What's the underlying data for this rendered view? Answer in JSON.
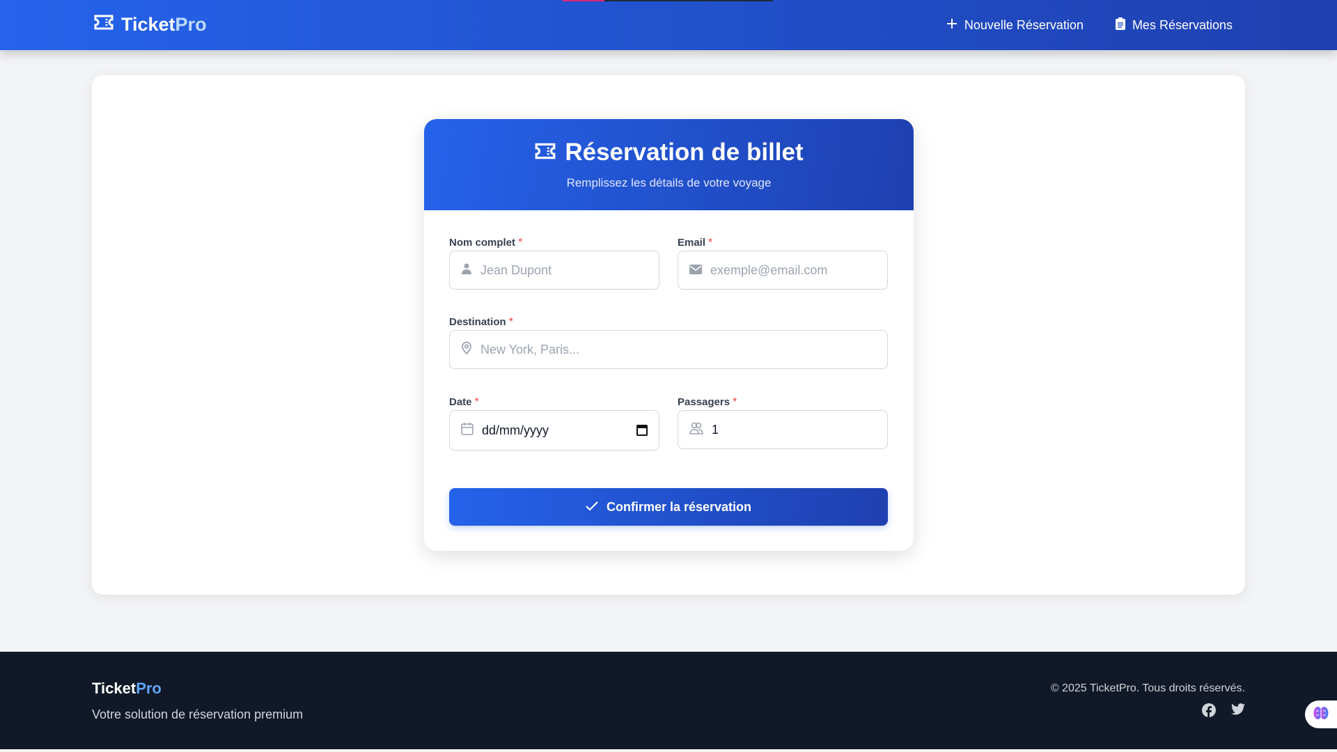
{
  "header": {
    "logo_main": "Ticket",
    "logo_accent": "Pro",
    "nav": [
      {
        "label": "Nouvelle Réservation",
        "icon": "plus-icon"
      },
      {
        "label": "Mes Réservations",
        "icon": "clipboard-icon"
      }
    ]
  },
  "form": {
    "title": "Réservation de billet",
    "subtitle": "Remplissez les détails de votre voyage",
    "required_mark": "*",
    "fields": {
      "name": {
        "label": "Nom complet",
        "placeholder": "Jean Dupont"
      },
      "email": {
        "label": "Email",
        "placeholder": "exemple@email.com"
      },
      "destination": {
        "label": "Destination",
        "placeholder": "New York, Paris..."
      },
      "date": {
        "label": "Date",
        "value": "dd/mm/yyyy"
      },
      "passengers": {
        "label": "Passagers",
        "value": "1"
      }
    },
    "submit_label": "Confirmer la réservation"
  },
  "footer": {
    "logo_main": "Ticket",
    "logo_accent": "Pro",
    "tagline": "Votre solution de réservation premium",
    "copyright": "© 2025 TicketPro. Tous droits réservés."
  },
  "colors": {
    "primary": "#2563eb",
    "primary_dark": "#1e40af",
    "footer_bg": "#111827",
    "required": "#ef4444"
  }
}
